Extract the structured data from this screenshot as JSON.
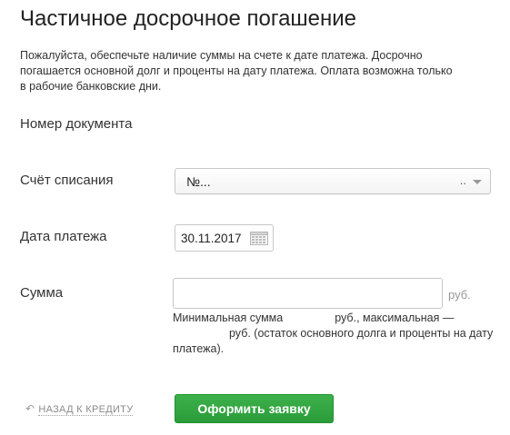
{
  "page": {
    "title": "Частичное досрочное погашение",
    "intro_lines": [
      "Пожалуйста, обеспечьте наличие суммы на счете к дате платежа. Досрочно",
      "погашается основной долг и проценты на дату платежа. Оплата возможна только",
      "в рабочие банковские дни."
    ]
  },
  "form": {
    "document_number_label": "Номер документа",
    "account": {
      "label": "Счёт списания",
      "value": "№...",
      "suffix": "..",
      "icon": "chevron-down-icon"
    },
    "payment_date": {
      "label": "Дата платежа",
      "value": "30.11.2017",
      "icon": "calendar-icon"
    },
    "amount": {
      "label": "Сумма",
      "value": "",
      "unit": "руб.",
      "hint_line1_part1": "Минимальная сумма",
      "hint_line1_part2": "руб., максимальная —",
      "hint_line2": "руб. (остаток основного долга и проценты на дату",
      "hint_line3": "платежа)."
    }
  },
  "actions": {
    "back_label": "НАЗАД К КРЕДИТУ",
    "back_icon": "return-arrow-icon",
    "submit_label": "Оформить заявку"
  },
  "colors": {
    "submit_bg": "#2ea23c",
    "text": "#333333",
    "muted": "#8a8a8a"
  }
}
